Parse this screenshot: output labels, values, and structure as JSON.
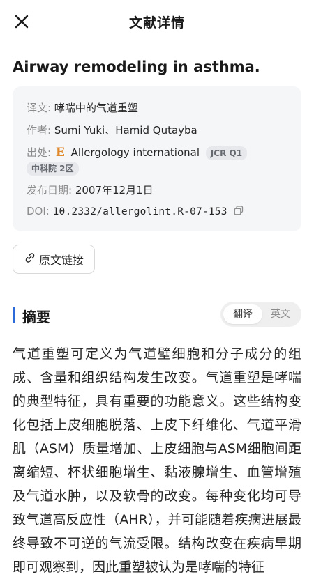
{
  "header": {
    "title": "文献详情"
  },
  "paper": {
    "title": "Airway remodeling in asthma.",
    "translation_label": "译文:",
    "translation": "哮喘中的气道重塑",
    "authors_label": "作者:",
    "authors": "Sumi Yuki、Hamid Qutayba",
    "source_label": "出处:",
    "journal_icon": "E",
    "journal": "Allergology international",
    "tags": [
      "JCR Q1",
      "中科院 2区"
    ],
    "date_label": "发布日期:",
    "date": "2007年12月1日",
    "doi_label": "DOI:",
    "doi": "10.2332/allergolint.R-07-153"
  },
  "actions": {
    "original_link": "原文链接"
  },
  "abstract": {
    "heading": "摘要",
    "toggle": {
      "translated": "翻译",
      "english": "英文",
      "selected": "翻译"
    },
    "text": "气道重塑可定义为气道壁细胞和分子成分的组成、含量和组织结构发生改变。气道重塑是哮喘的典型特征，具有重要的功能意义。这些结构变化包括上皮细胞脱落、上皮下纤维化、气道平滑肌（ASM）质量增加、上皮细胞与ASM细胞间距离缩短、杯状细胞增生、黏液腺增生、血管增殖及气道水肿，以及软骨的改变。每种变化均可导致气道高反应性（AHR），并可能随着疾病进展最终导致不可逆的气流受限。结构改变在疾病早期即可观察到，因此重塑被认为是哮喘的特征"
  },
  "colors": {
    "accent": "#2b6ad8",
    "journal_icon": "#e08a2c",
    "card_bg": "#f5f6f8"
  }
}
